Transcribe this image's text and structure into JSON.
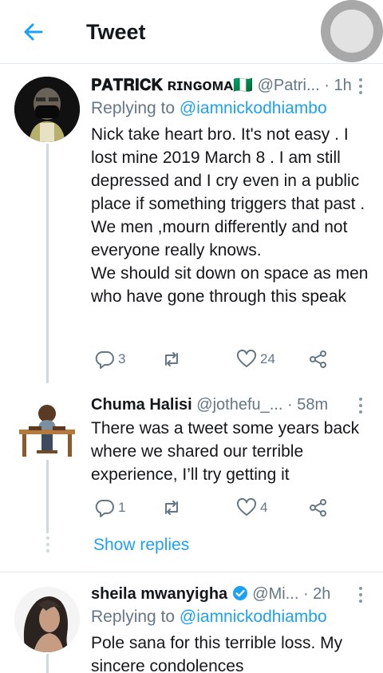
{
  "header": {
    "title": "Tweet",
    "back_icon": "arrow-left-icon",
    "accent": "#1da1f2"
  },
  "tweets": [
    {
      "name": "𝐏𝐀𝐓𝐑𝐈𝐂𝐊 ʀɪɴɢᴏᴍᴀ🇳🇬",
      "handle": "@Patri...",
      "time": "· 1h",
      "replying_prefix": "Replying to ",
      "replying_to": "@iamnickodhiambo",
      "text": "Nick take heart bro. It's not easy . I lost mine 2019 March 8 . I am still depressed and I cry even in a public place if  something triggers that past .  We men ,mourn differently and not everyone really knows.\nWe should sit down on space as men who have gone through this speak",
      "replies": "3",
      "retweets": "",
      "likes": "24"
    },
    {
      "name": "Chuma Halisi",
      "handle": "@jothefu_...",
      "time": "· 58m",
      "text": "There was a tweet some years back where we shared our terrible experience, I’ll try getting it",
      "replies": "1",
      "retweets": "",
      "likes": "4",
      "show_replies": "Show replies"
    },
    {
      "name": "sheila mwanyigha",
      "handle": "@Mi...",
      "time": "· 2h",
      "verified": true,
      "replying_prefix": "Replying to ",
      "replying_to": "@iamnickodhiambo",
      "text": "Pole sana for this terrible loss. My sincere condolences"
    }
  ]
}
